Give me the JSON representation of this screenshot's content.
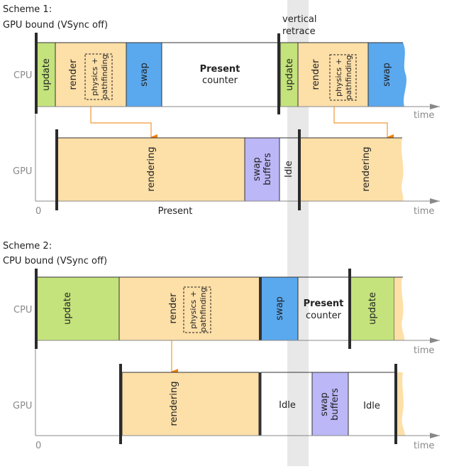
{
  "colors": {
    "update": "#c4e37c",
    "render": "#fddfa8",
    "swap": "#5aa8ee",
    "swap_buffers": "#bcb7f7",
    "idle": "#ffffff",
    "vertical_retrace_band": "#e8e8e8",
    "arrow": "#f07f0a",
    "axis": "#888888",
    "marker": "#2b2b2b"
  },
  "vertical_retrace": {
    "label_line1": "vertical",
    "label_line2": "retrace"
  },
  "schemes": [
    {
      "title_line1": "Scheme 1:",
      "title_line2": "GPU bound (VSync off)",
      "cpu": {
        "lane_label": "CPU",
        "axis_label": "time",
        "segments": [
          {
            "label": "update",
            "type": "update"
          },
          {
            "label": "render",
            "type": "render",
            "inner_label_line1": "physics +",
            "inner_label_line2": "pathfinding"
          },
          {
            "label": "swap",
            "type": "swap"
          },
          {
            "label_line1": "Present",
            "label_line2": "counter",
            "type": "idle"
          },
          {
            "label": "update",
            "type": "update"
          },
          {
            "label": "render",
            "type": "render",
            "inner_label_line1": "physics +",
            "inner_label_line2": "pathfinding"
          },
          {
            "label": "swap",
            "type": "swap"
          }
        ]
      },
      "gpu": {
        "lane_label": "GPU",
        "axis_label": "time",
        "origin_label": "0",
        "present_label": "Present",
        "segments": [
          {
            "label": "rendering",
            "type": "render"
          },
          {
            "label_line1": "swap",
            "label_line2": "buffers",
            "type": "swap_buffers"
          },
          {
            "label": "Idle",
            "type": "idle"
          },
          {
            "label": "rendering",
            "type": "render"
          }
        ]
      }
    },
    {
      "title_line1": "Scheme 2:",
      "title_line2": "CPU bound (VSync off)",
      "cpu": {
        "lane_label": "CPU",
        "axis_label": "time",
        "segments": [
          {
            "label": "update",
            "type": "update"
          },
          {
            "label": "render",
            "type": "render",
            "inner_label_line1": "physics +",
            "inner_label_line2": "pathfinding"
          },
          {
            "label": "swap",
            "type": "swap"
          },
          {
            "label_line1": "Present",
            "label_line2": "counter",
            "type": "idle"
          },
          {
            "label": "update",
            "type": "update"
          },
          {
            "label": "",
            "type": "render"
          }
        ]
      },
      "gpu": {
        "lane_label": "GPU",
        "axis_label": "time",
        "origin_label": "0",
        "segments": [
          {
            "label": "rendering",
            "type": "render"
          },
          {
            "label": "Idle",
            "type": "idle"
          },
          {
            "label_line1": "swap",
            "label_line2": "buffers",
            "type": "swap_buffers"
          },
          {
            "label": "Idle",
            "type": "idle"
          },
          {
            "label": "",
            "type": "render"
          }
        ]
      }
    }
  ]
}
